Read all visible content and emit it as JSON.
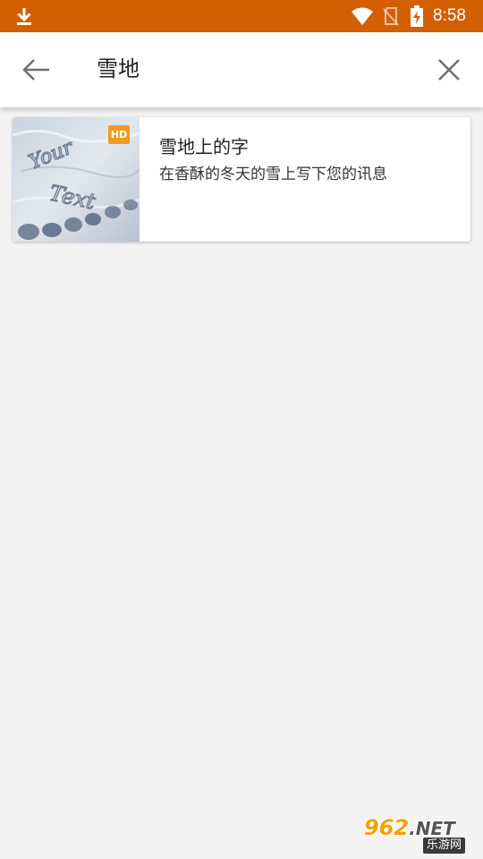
{
  "status_bar": {
    "time": "8:58",
    "background": "#d35f00",
    "icons": [
      "download-icon",
      "wifi-icon",
      "no-sim-icon",
      "battery-charging-icon"
    ]
  },
  "search": {
    "query": "雪地",
    "back_icon": "arrow-left-icon",
    "clear_icon": "close-icon"
  },
  "results": [
    {
      "title": "雪地上的字",
      "subtitle": "在香酥的冬天的雪上写下您的讯息",
      "badge": "HD",
      "badge_color": "#f09a1e",
      "thumbnail_text": [
        "Your",
        "Text"
      ]
    }
  ],
  "watermark": {
    "main": "962",
    "suffix": ".NET",
    "sub": "乐游网"
  }
}
